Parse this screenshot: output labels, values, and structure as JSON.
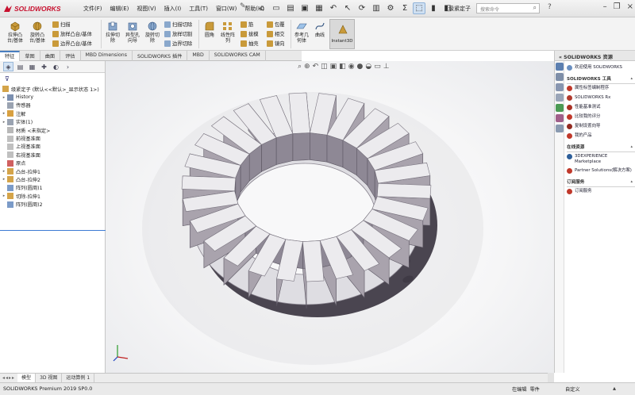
{
  "app": {
    "logo": "SOLIDWORKS",
    "menus": [
      "文件(F)",
      "编辑(E)",
      "视图(V)",
      "插入(I)",
      "工具(T)",
      "窗口(W)",
      "帮助(H)"
    ],
    "document_title": "级紧定子",
    "search_placeholder": "搜索命令"
  },
  "ribbon": {
    "large": [
      {
        "label_1": "拉伸凸",
        "label_2": "台/基体"
      },
      {
        "label_1": "旋转凸",
        "label_2": "台/基体"
      },
      {
        "label_1": "拉伸切",
        "label_2": "除"
      },
      {
        "label_1": "异型孔",
        "label_2": "向导"
      },
      {
        "label_1": "旋转切",
        "label_2": "除"
      },
      {
        "label_1": "圆角",
        "label_2": ""
      },
      {
        "label_1": "线性阵",
        "label_2": "列"
      },
      {
        "label_1": "参考几",
        "label_2": "何体"
      },
      {
        "label_1": "曲线",
        "label_2": ""
      }
    ],
    "small": [
      "扫描",
      "放样凸台/基体",
      "边界凸台/基体",
      "扫描切除",
      "放样切割",
      "边界切除",
      "筋",
      "拔模",
      "抽壳",
      "包覆",
      "相交",
      "镜向"
    ],
    "instant3d": "Instant3D"
  },
  "command_tabs": [
    "特征",
    "草图",
    "曲面",
    "评估",
    "MBD Dimensions",
    "SOLIDWORKS 插件",
    "MBD",
    "SOLIDWORKS CAM"
  ],
  "tree": {
    "root": "级紧定子 (默认<<默认>_显示状态 1>)",
    "items": [
      {
        "label": "History",
        "expand": "▸",
        "color": "#7b8fb0"
      },
      {
        "label": "传感器",
        "expand": "",
        "color": "#9aa3b1"
      },
      {
        "label": "注解",
        "expand": "▸",
        "color": "#d8a040"
      },
      {
        "label": "实体(1)",
        "expand": "▸",
        "color": "#9aa3b1"
      },
      {
        "label": "材质 <未指定>",
        "expand": "",
        "color": "#b8b8b8"
      },
      {
        "label": "前视基准面",
        "expand": "",
        "color": "#c0c0c0"
      },
      {
        "label": "上视基准面",
        "expand": "",
        "color": "#c0c0c0"
      },
      {
        "label": "右视基准面",
        "expand": "",
        "color": "#c0c0c0"
      },
      {
        "label": "原点",
        "expand": "",
        "color": "#d06060"
      },
      {
        "label": "凸台-拉伸1",
        "expand": "▸",
        "color": "#d4a44a"
      },
      {
        "label": "凸台-拉伸2",
        "expand": "▸",
        "color": "#d4a44a"
      },
      {
        "label": "阵列(圆周)1",
        "expand": "",
        "color": "#7b9bc8"
      },
      {
        "label": "切除-拉伸1",
        "expand": "▸",
        "color": "#d4a44a"
      },
      {
        "label": "阵列(圆周)2",
        "expand": "",
        "color": "#7b9bc8"
      }
    ]
  },
  "taskpane": {
    "title": "SOLIDWORKS 资源",
    "welcome": "欢迎使用 SOLIDWORKS",
    "tools_header": "SOLIDWORKS 工具",
    "tools": [
      "属性标签编制程序",
      "SOLIDWORKS Rx",
      "性能基准测试",
      "比较我的评分",
      "复制设置向导",
      "我的产品"
    ],
    "online_header": "在线资源",
    "online": [
      "3DEXPERIENCE Marketplace",
      "Partner Solutions(解决方案)"
    ],
    "sub_header": "订阅服务",
    "sub": [
      "订阅服务"
    ]
  },
  "bottom_tabs": [
    "模型",
    "3D 视图",
    "运动算例 1"
  ],
  "status": {
    "version": "SOLIDWORKS Premium 2019 SP0.0",
    "edit": "在编辑",
    "units": "零件",
    "custom": "自定义"
  },
  "colors": {
    "accent": "#4a7ec0",
    "brand_red": "#c8102e",
    "model_face": "#a9a3ad",
    "model_light": "#ecebee",
    "model_dark": "#4a4550"
  }
}
